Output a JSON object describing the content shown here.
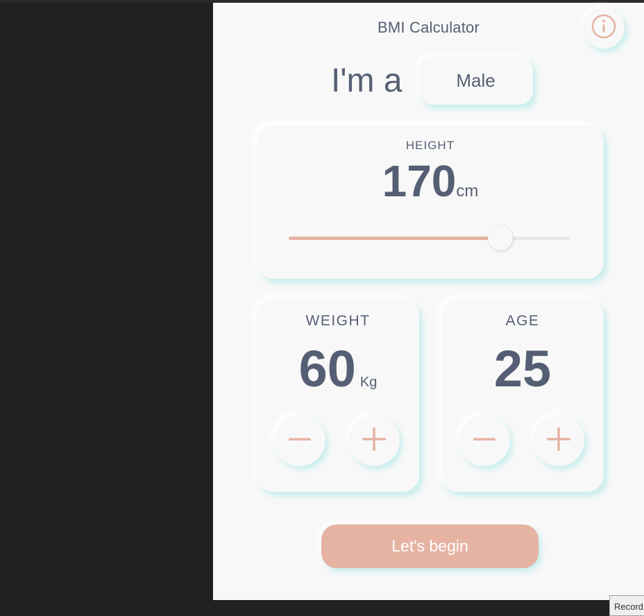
{
  "app": {
    "title": "BMI Calculator"
  },
  "gender": {
    "label": "I'm a",
    "value": "Male"
  },
  "height": {
    "label": "HEIGHT",
    "value": "170",
    "unit": "cm",
    "slider_fraction": 0.75
  },
  "weight": {
    "label": "WEIGHT",
    "value": "60",
    "unit": "Kg"
  },
  "age": {
    "label": "AGE",
    "value": "25"
  },
  "icons": {
    "info": "info-icon",
    "minus": "minus-icon",
    "plus": "plus-icon"
  },
  "cta": {
    "label": "Let's begin"
  },
  "overlay": {
    "recorder_label": "Record"
  },
  "colors": {
    "accent": "#e6b3a3",
    "text": "#555f73",
    "panel": "#f8f8f8",
    "shadow": "#a0e6e4",
    "background": "#212121"
  }
}
